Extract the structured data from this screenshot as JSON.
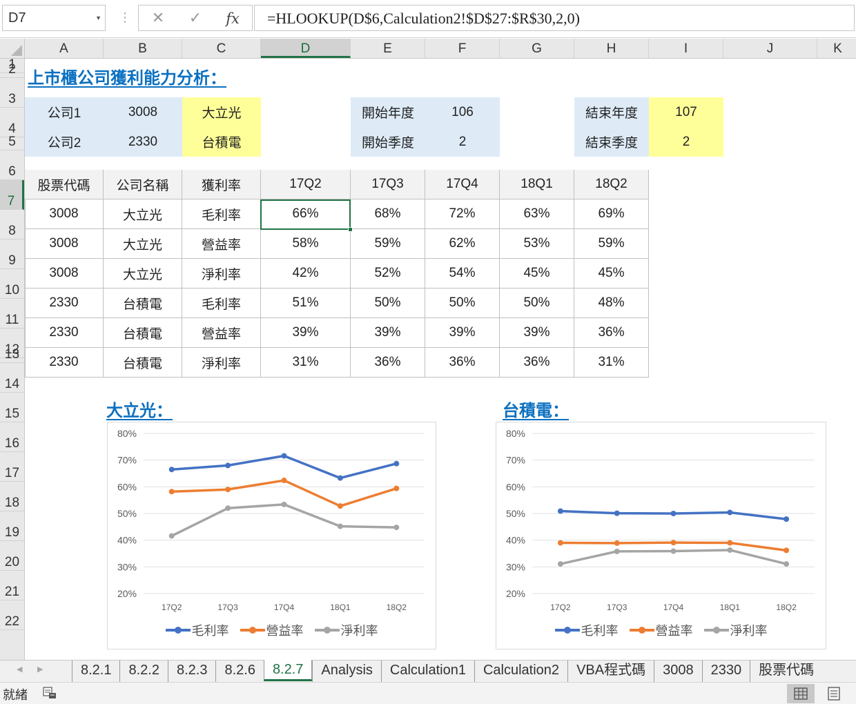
{
  "formula_bar": {
    "name_box": "D7",
    "cancel_icon": "✕",
    "enter_icon": "✓",
    "fx_label": "fx",
    "formula": "=HLOOKUP(D$6,Calculation2!$D$27:$R$30,2,0)"
  },
  "columns": [
    "A",
    "B",
    "C",
    "D",
    "E",
    "F",
    "G",
    "H",
    "I",
    "J",
    "K"
  ],
  "rows": [
    "1",
    "2",
    "3",
    "4",
    "5",
    "6",
    "7",
    "8",
    "9",
    "10",
    "11",
    "12",
    "13",
    "14",
    "15",
    "16",
    "17",
    "18",
    "19",
    "20",
    "21",
    "22"
  ],
  "sheet": {
    "title": "上市櫃公司獲利能力分析：",
    "input": {
      "company1_label": "公司1",
      "company1_code": "3008",
      "company1_name": "大立光",
      "company2_label": "公司2",
      "company2_code": "2330",
      "company2_name": "台積電",
      "start_year_label": "開始年度",
      "start_year": "106",
      "start_quarter_label": "開始季度",
      "start_quarter": "2",
      "end_year_label": "結束年度",
      "end_year": "107",
      "end_quarter_label": "結束季度",
      "end_quarter": "2"
    },
    "table": {
      "headers": [
        "股票代碼",
        "公司名稱",
        "獲利率",
        "17Q2",
        "17Q3",
        "17Q4",
        "18Q1",
        "18Q2"
      ],
      "rows": [
        [
          "3008",
          "大立光",
          "毛利率",
          "66%",
          "68%",
          "72%",
          "63%",
          "69%"
        ],
        [
          "3008",
          "大立光",
          "營益率",
          "58%",
          "59%",
          "62%",
          "53%",
          "59%"
        ],
        [
          "3008",
          "大立光",
          "淨利率",
          "42%",
          "52%",
          "54%",
          "45%",
          "45%"
        ],
        [
          "2330",
          "台積電",
          "毛利率",
          "51%",
          "50%",
          "50%",
          "50%",
          "48%"
        ],
        [
          "2330",
          "台積電",
          "營益率",
          "39%",
          "39%",
          "39%",
          "39%",
          "36%"
        ],
        [
          "2330",
          "台積電",
          "淨利率",
          "31%",
          "36%",
          "36%",
          "36%",
          "31%"
        ]
      ]
    },
    "chart1_title": "大立光：",
    "chart2_title": "台積電："
  },
  "colors": {
    "series": [
      "#4472c4",
      "#ed7d31",
      "#a5a5a5"
    ],
    "accent": "#217346",
    "title": "#0b70c0",
    "input_blue": "#deebf7",
    "input_yellow": "#ffff99"
  },
  "chart_data": [
    {
      "type": "line",
      "categories": [
        "17Q2",
        "17Q3",
        "17Q4",
        "18Q1",
        "18Q2"
      ],
      "series": [
        {
          "name": "毛利率",
          "values": [
            66.5,
            68.0,
            71.6,
            63.3,
            68.7
          ]
        },
        {
          "name": "營益率",
          "values": [
            58.2,
            59.0,
            62.4,
            52.8,
            59.4
          ]
        },
        {
          "name": "淨利率",
          "values": [
            41.6,
            52.0,
            53.4,
            45.2,
            44.8
          ]
        }
      ],
      "ylim": [
        20,
        80
      ],
      "yticks": [
        "20%",
        "30%",
        "40%",
        "50%",
        "60%",
        "70%",
        "80%"
      ],
      "grid": true,
      "legend": "bottom"
    },
    {
      "type": "line",
      "categories": [
        "17Q2",
        "17Q3",
        "17Q4",
        "18Q1",
        "18Q2"
      ],
      "series": [
        {
          "name": "毛利率",
          "values": [
            50.9,
            50.1,
            50.0,
            50.4,
            47.9
          ]
        },
        {
          "name": "營益率",
          "values": [
            39.0,
            38.9,
            39.1,
            39.0,
            36.2
          ]
        },
        {
          "name": "淨利率",
          "values": [
            31.1,
            35.8,
            35.9,
            36.3,
            31.1
          ]
        }
      ],
      "ylim": [
        20,
        80
      ],
      "yticks": [
        "20%",
        "30%",
        "40%",
        "50%",
        "60%",
        "70%",
        "80%"
      ],
      "grid": true,
      "legend": "bottom"
    }
  ],
  "tabs": [
    "8.2.1",
    "8.2.2",
    "8.2.3",
    "8.2.6",
    "8.2.7",
    "Analysis",
    "Calculation1",
    "Calculation2",
    "VBA程式碼",
    "3008",
    "2330",
    "股票代碼"
  ],
  "active_tab": "8.2.7",
  "status": {
    "ready": "就緒"
  }
}
